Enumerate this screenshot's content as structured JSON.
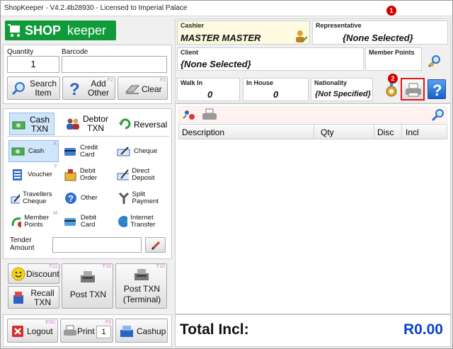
{
  "title": "ShopKeeper - V4.2.4b28930 - Licensed to Imperial Palace",
  "logo": {
    "shop": "SHOP",
    "keeper": "keeper"
  },
  "badges": {
    "one": "1",
    "two": "2"
  },
  "entry": {
    "quantity_label": "Quantity",
    "quantity_value": "1",
    "barcode_label": "Barcode",
    "barcode_value": ""
  },
  "actions": {
    "search_item": "Search Item",
    "add_other": "Add Other",
    "add_other_key": "F2",
    "clear": "Clear",
    "clear_key": "F3"
  },
  "txn_tabs": [
    {
      "label": "Cash TXN",
      "icon": "cash-icon"
    },
    {
      "label": "Debtor TXN",
      "icon": "debtor-icon"
    },
    {
      "label": "Reversal",
      "icon": "reversal-icon"
    }
  ],
  "tenders": [
    {
      "label": "Cash",
      "key": "A",
      "icon": "cash-icon"
    },
    {
      "label": "Credit Card",
      "key": "",
      "icon": "credit-card-icon"
    },
    {
      "label": "Cheque",
      "key": "",
      "icon": "cheque-icon"
    },
    {
      "label": "Voucher",
      "key": "F",
      "icon": "voucher-icon"
    },
    {
      "label": "Debit Order",
      "key": "",
      "icon": "debit-order-icon"
    },
    {
      "label": "Direct Deposit",
      "key": "",
      "icon": "direct-deposit-icon"
    },
    {
      "label": "Travellers Cheque",
      "key": "",
      "icon": "travellers-cheque-icon"
    },
    {
      "label": "Other",
      "key": "",
      "icon": "other-icon"
    },
    {
      "label": "Split Payment",
      "key": "",
      "icon": "split-payment-icon"
    },
    {
      "label": "Member Points",
      "key": "M",
      "icon": "member-points-icon"
    },
    {
      "label": "Debit Card",
      "key": "",
      "icon": "debit-card-icon"
    },
    {
      "label": "Internet Transfer",
      "key": "",
      "icon": "internet-transfer-icon"
    }
  ],
  "tender_amount": {
    "label": "Tender Amount",
    "value": ""
  },
  "post": {
    "discount": "Discount",
    "discount_key": "F11",
    "recall": "Recall TXN",
    "post_txn": "Post TXN",
    "post_key": "F10",
    "post_terminal": "Post TXN (Terminal)",
    "post_terminal_key": "F10"
  },
  "footer": {
    "logout": "Logout",
    "logout_key": "ESC",
    "print": "Print",
    "print_key": "F9",
    "print_copies": "1",
    "cashup": "Cashup"
  },
  "cashier": {
    "label": "Cashier",
    "value": "MASTER MASTER"
  },
  "representative": {
    "label": "Representative",
    "value": "{None Selected}"
  },
  "client": {
    "label": "Client",
    "value": "{None Selected}"
  },
  "member_points": {
    "label": "Member Points",
    "value": ""
  },
  "walk_in": {
    "label": "Walk In",
    "value": "0"
  },
  "in_house": {
    "label": "In House",
    "value": "0"
  },
  "nationality": {
    "label": "Nationality",
    "value": "{Not Specified}"
  },
  "grid": {
    "columns": [
      "Description",
      "Qty",
      "Disc",
      "Incl"
    ]
  },
  "total": {
    "label": "Total Incl:",
    "value": "R0.00"
  },
  "colors": {
    "accent": "#1a6fc9",
    "logo_green": "#0f9b3a",
    "total_blue": "#0b3fd0",
    "highlight_red": "#e01818"
  }
}
